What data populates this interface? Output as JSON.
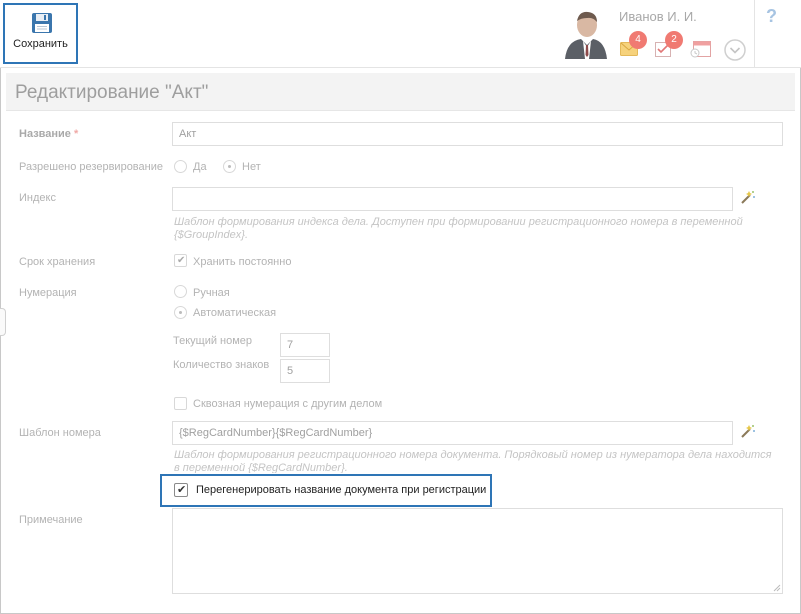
{
  "toolbar": {
    "save_label": "Сохранить"
  },
  "user": {
    "name": "Иванов И. И."
  },
  "notifications": {
    "mail_count": "4",
    "tasks_count": "2"
  },
  "help": {
    "label": "?"
  },
  "page": {
    "title": "Редактирование \"Акт\""
  },
  "form": {
    "name": {
      "label": "Название",
      "required_mark": "*",
      "value": "Акт"
    },
    "reservation": {
      "label": "Разрешено резервирование",
      "yes": "Да",
      "no": "Нет",
      "selected": "Нет"
    },
    "index": {
      "label": "Индекс",
      "value": "",
      "hint": "Шаблон формирования индекса дела. Доступен при формировании регистрационного номера в переменной {$GroupIndex}."
    },
    "storage": {
      "label": "Срок хранения",
      "keep_forever": "Хранить постоянно",
      "checked": true
    },
    "numbering": {
      "label": "Нумерация",
      "manual": "Ручная",
      "auto": "Автоматическая",
      "selected": "Автоматическая",
      "current_number_label": "Текущий номер",
      "current_number": "7",
      "digits_label": "Количество знаков",
      "digits": "5",
      "cross_numbering": "Сквозная нумерация с другим делом"
    },
    "number_template": {
      "label": "Шаблон номера",
      "value": "{$RegCardNumber}{$RegCardNumber}",
      "hint": "Шаблон формирования регистрационного номера документа. Порядковый номер из нумератора дела находится в переменной {$RegCardNumber}."
    },
    "regenerate": {
      "label": "Перегенерировать название документа при регистрации",
      "checked": true
    },
    "note": {
      "label": "Примечание",
      "value": ""
    }
  },
  "icons": {
    "save": "floppy-disk-icon",
    "mail": "envelope-icon",
    "tasks": "task-icon",
    "calendar": "calendar-icon",
    "expand": "chevron-down-circle-icon",
    "wand": "magic-wand-icon"
  },
  "colors": {
    "accent": "#2e75b6",
    "badge": "#f07a72",
    "help": "#a7c4e2"
  }
}
